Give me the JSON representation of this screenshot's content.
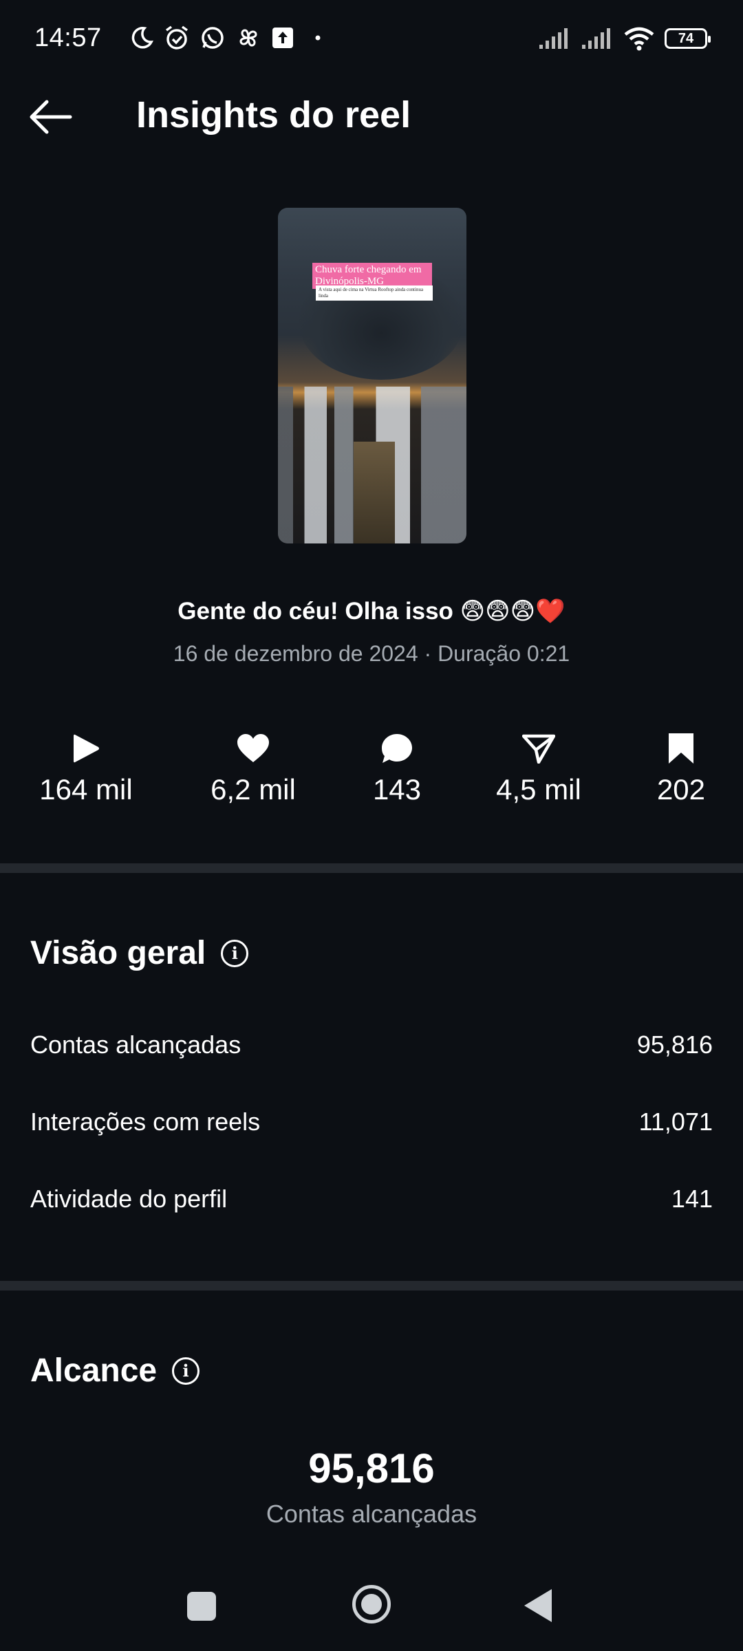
{
  "status_bar": {
    "time": "14:57",
    "battery": "74",
    "icons_left": [
      "moon-icon",
      "alarm-icon",
      "whatsapp-icon",
      "pinwheel-icon",
      "upload-icon",
      "dot-icon"
    ],
    "icons_right": [
      "signal-icon",
      "signal-icon",
      "wifi-icon",
      "battery-icon"
    ]
  },
  "header": {
    "title": "Insights do reel",
    "back_icon": "arrow-left-icon"
  },
  "thumbnail": {
    "overlay_title": "Chuva forte chegando em Divinópolis-MG",
    "overlay_subtitle": "A vista aqui de cima na Virtua Rooftop ainda continua linda"
  },
  "reel": {
    "caption": "Gente do céu! Olha isso 😨😨😨❤️",
    "meta": "16 de dezembro de 2024 · Duração 0:21"
  },
  "stats": [
    {
      "icon": "play-icon",
      "value": "164 mil"
    },
    {
      "icon": "heart-icon",
      "value": "6,2 mil"
    },
    {
      "icon": "comment-icon",
      "value": "143"
    },
    {
      "icon": "send-icon",
      "value": "4,5 mil"
    },
    {
      "icon": "bookmark-icon",
      "value": "202"
    }
  ],
  "overview": {
    "title": "Visão geral",
    "rows": [
      {
        "label": "Contas alcançadas",
        "value": "95,816"
      },
      {
        "label": "Interações com reels",
        "value": "11,071"
      },
      {
        "label": "Atividade do perfil",
        "value": "141"
      }
    ]
  },
  "reach": {
    "title": "Alcance",
    "value": "95,816",
    "label": "Contas alcançadas"
  },
  "colors": {
    "background": "#0c0f14",
    "divider": "#24282e",
    "secondary_text": "#a6acb3",
    "caption_pink": "#f06aa5"
  }
}
